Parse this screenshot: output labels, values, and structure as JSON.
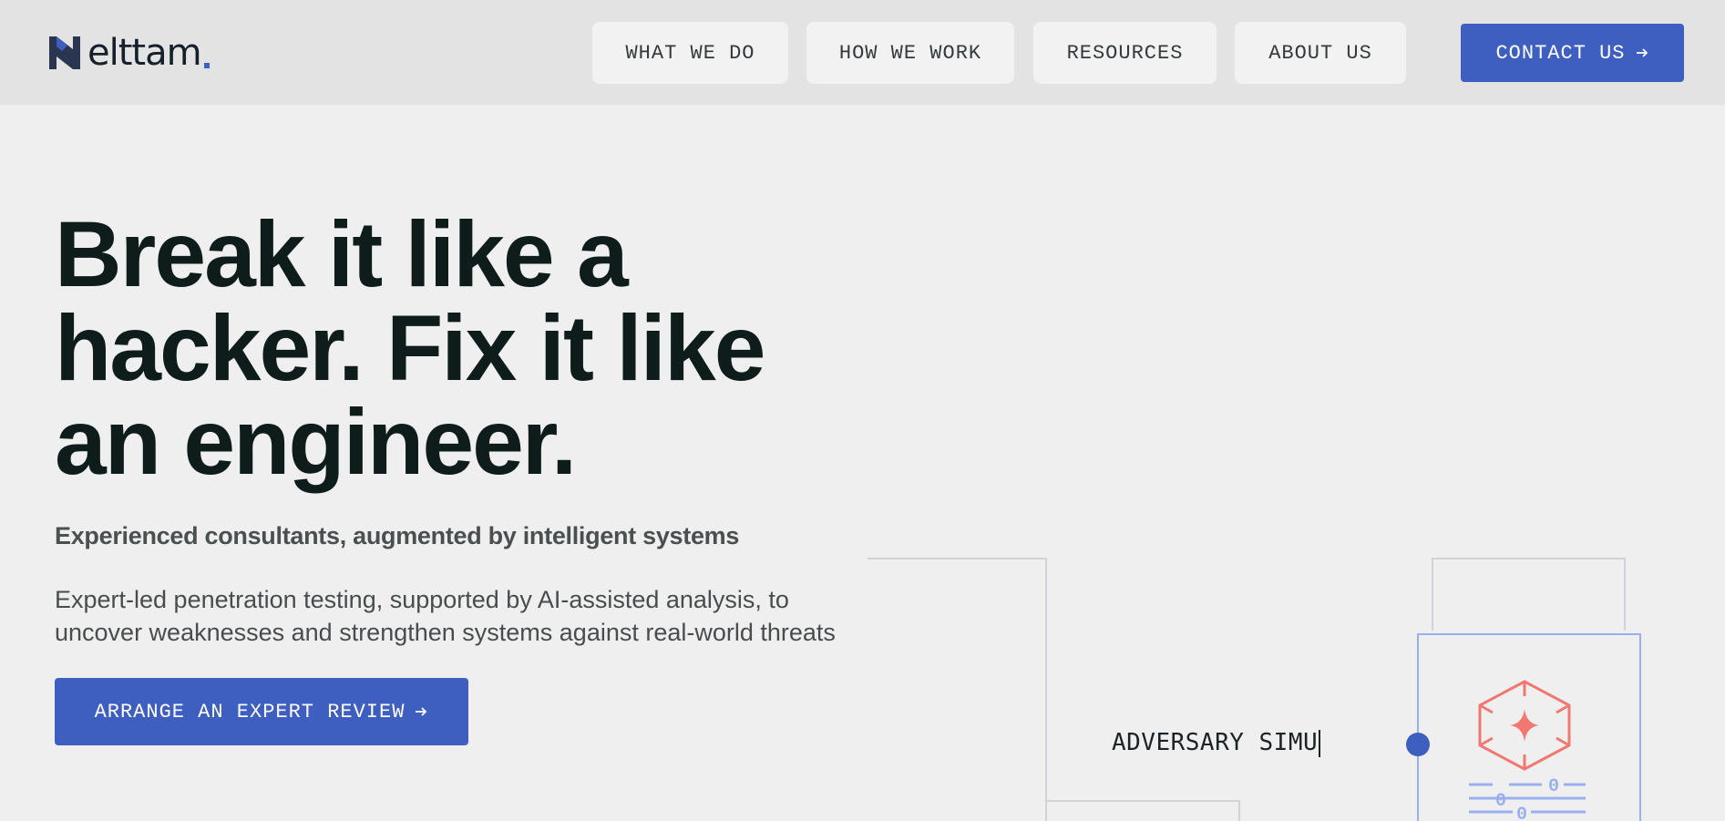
{
  "brand": {
    "name": "elttam",
    "accent_color": "#3f5fc0"
  },
  "nav": {
    "items": [
      {
        "label": "WHAT WE DO"
      },
      {
        "label": "HOW WE WORK"
      },
      {
        "label": "RESOURCES"
      },
      {
        "label": "ABOUT US"
      }
    ],
    "contact": {
      "label": "CONTACT US",
      "icon": "arrow-right-icon"
    }
  },
  "hero": {
    "title": "Break it like a hacker. Fix it like an engineer.",
    "subtitle": "Experienced consultants, augmented by intelligent systems",
    "description": "Expert-led penetration testing, supported by AI-assisted analysis, to uncover weaknesses and strengthen systems against real-world threats",
    "cta": {
      "label": "ARRANGE AN EXPERT REVIEW",
      "icon": "arrow-right-icon"
    }
  },
  "diagram": {
    "typing_text": "ADVERSARY SIMU",
    "node_icon": "hexagon-sparkle-icon",
    "node_color": "#f07870",
    "connector_color": "#3f5fc0",
    "line_color": "#9ab0ee"
  }
}
